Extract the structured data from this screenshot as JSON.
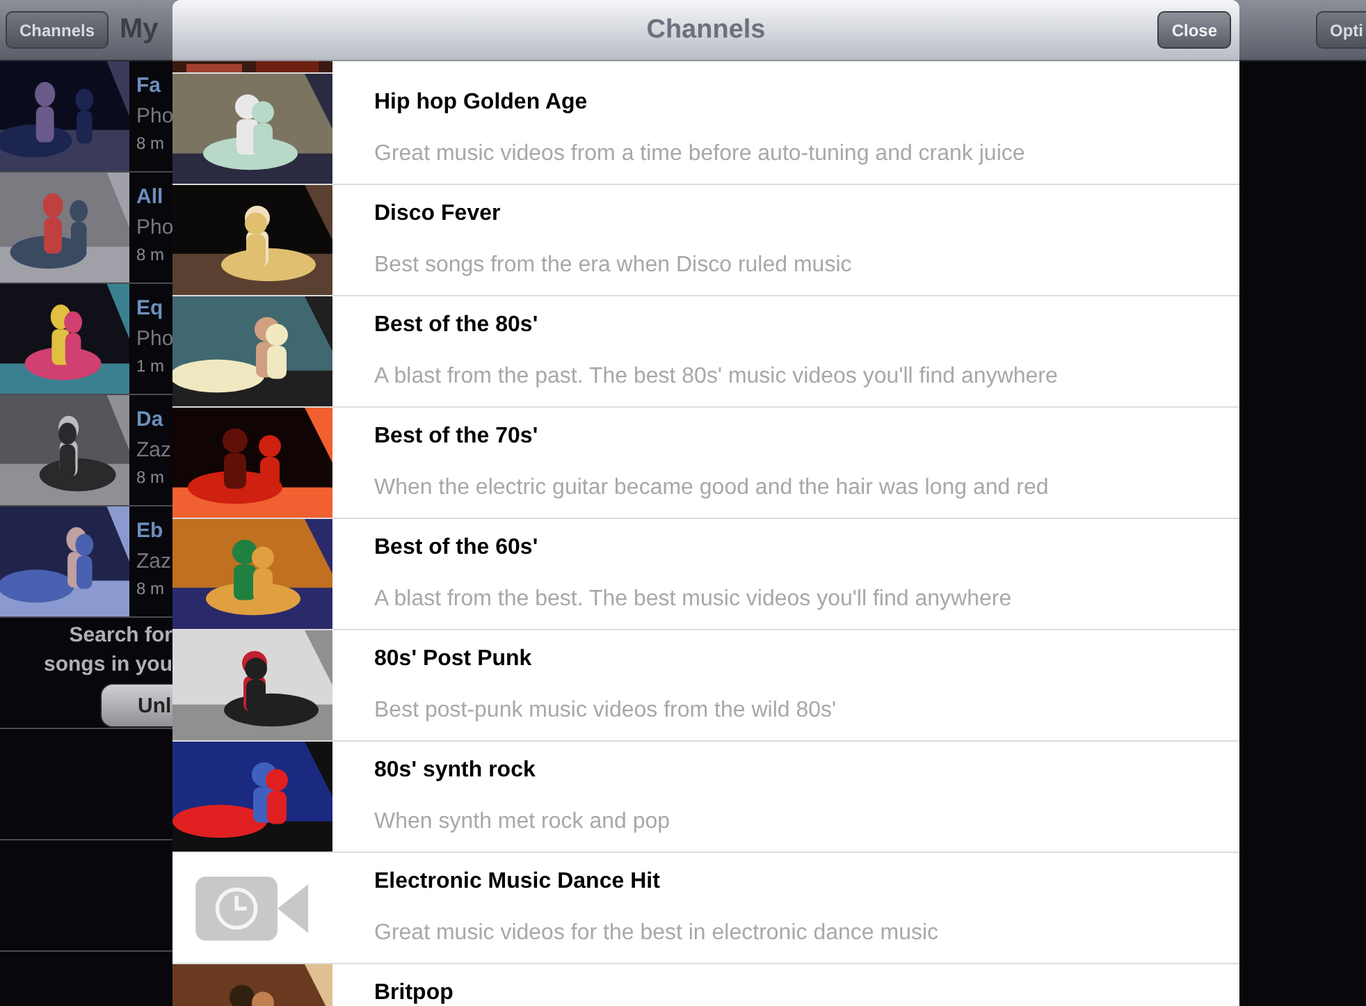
{
  "background": {
    "header": {
      "channels_button": "Channels",
      "title": "My",
      "options_button": "Opti"
    },
    "videos": [
      {
        "title": "Fa",
        "artist": "Pho",
        "duration": "8 m"
      },
      {
        "title": "All",
        "artist": "Pho",
        "duration": "8 m"
      },
      {
        "title": "Eq",
        "artist": "Pho",
        "duration": "1 m"
      },
      {
        "title": "Da",
        "artist": "Zaz",
        "duration": "8 m"
      },
      {
        "title": "Eb",
        "artist": "Zaz",
        "duration": "8 m"
      }
    ],
    "search_prompt": [
      "Search for",
      "songs in you"
    ],
    "unlock_button": "Unl"
  },
  "modal": {
    "title": "Channels",
    "close_button": "Close",
    "channels": [
      {
        "title": "Hip hop Golden Age",
        "description": "Great music videos from a time before auto-tuning and crank juice"
      },
      {
        "title": "Disco Fever",
        "description": "Best songs from the era when Disco ruled music"
      },
      {
        "title": "Best of the 80s'",
        "description": "A blast from the past. The best 80s' music videos you'll find anywhere"
      },
      {
        "title": "Best of the 70s'",
        "description": "When the electric guitar became good and the hair was long and red"
      },
      {
        "title": "Best of the 60s'",
        "description": "A blast from the best. The best music videos you'll find anywhere"
      },
      {
        "title": "80s' Post Punk",
        "description": "Best post-punk music videos from the wild 80s'"
      },
      {
        "title": "80s' synth rock",
        "description": "When synth met rock and pop"
      },
      {
        "thumbnail": {
          "kind": "placeholder"
        },
        "title": "Electronic Music Dance Hit",
        "description": "Great music videos for the best in electronic dance music"
      },
      {
        "title": "Britpop"
      }
    ]
  }
}
